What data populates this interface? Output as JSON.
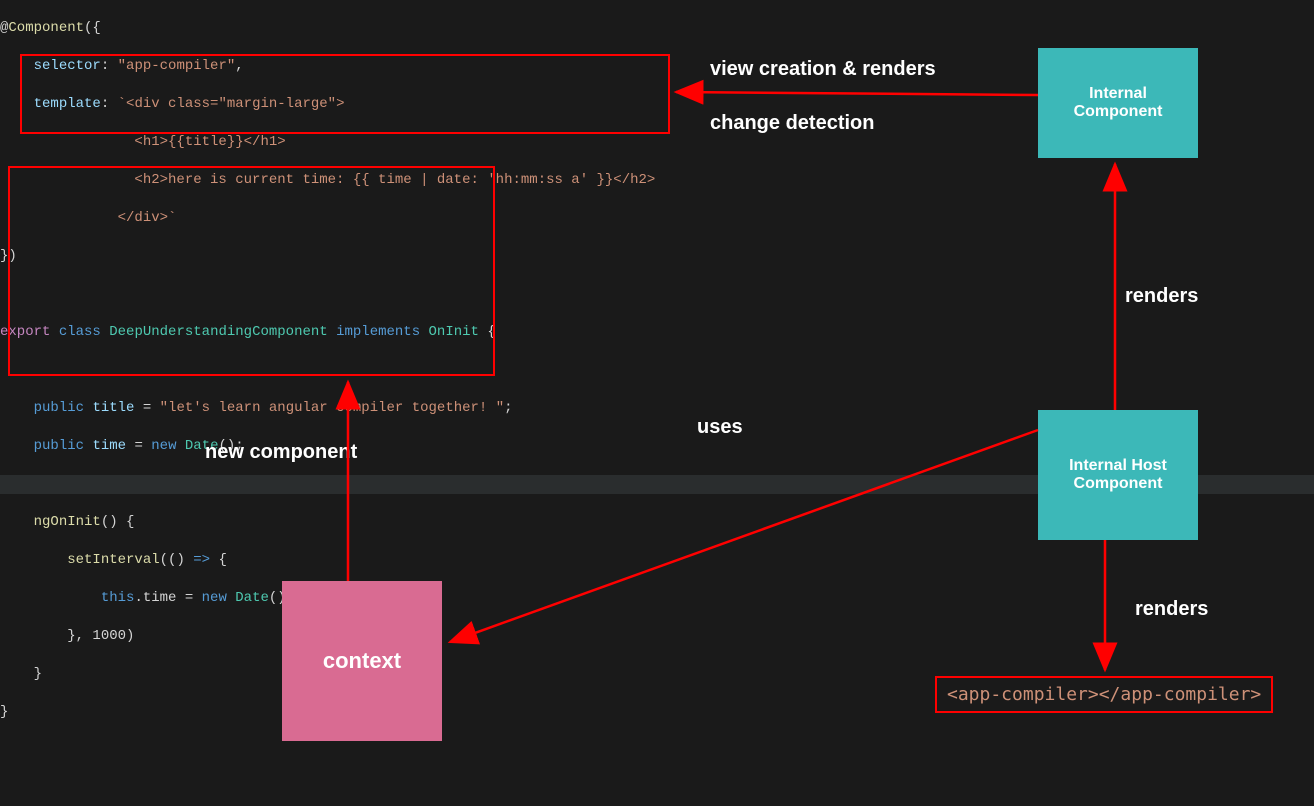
{
  "code": {
    "l1": "@Component({",
    "l2_key": "selector",
    "l2_val": "\"app-compiler\"",
    "l3_key": "template",
    "l3_val_start": "`<div class=\"margin-large\">",
    "l4": "<h1>{{title}}</h1>",
    "l5": "<h2>here is current time: {{ time | date: 'hh:mm:ss a' }}</h2>",
    "l6": "</div>`",
    "l7": "})",
    "l8_export": "export",
    "l8_class": "class",
    "l8_name": "DeepUnderstandingComponent",
    "l8_impl": "implements",
    "l8_iface": "OnInit",
    "l9_public": "public",
    "l9_title": "title",
    "l9_eq": " = ",
    "l9_val": "\"let's learn angular compiler together! \"",
    "l10_public": "public",
    "l10_time": "time",
    "l10_new": "new",
    "l10_date": "Date",
    "l11_ngOnInit": "ngOnInit",
    "l12_setInterval": "setInterval",
    "l13_this": "this",
    "l13_time": ".time = ",
    "l13_new": "new",
    "l13_date": "Date",
    "l14": "}, 1000)"
  },
  "boxes": {
    "internal_component": "Internal\nComponent",
    "internal_host": "Internal Host\nComponent",
    "context": "context"
  },
  "labels": {
    "view_creation": "view creation & renders",
    "change_detection": "change detection",
    "renders1": "renders",
    "renders2": "renders",
    "uses": "uses",
    "new_component": "new component"
  },
  "app_tag": "<app-compiler></app-compiler>"
}
